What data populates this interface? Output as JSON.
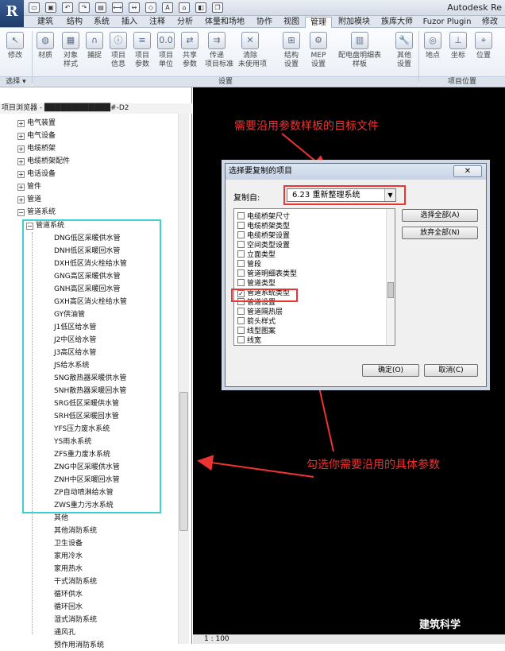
{
  "app": {
    "logo": "R",
    "title": "Autodesk Re"
  },
  "qat": {
    "icons": [
      "open-icon",
      "save-icon",
      "undo-icon",
      "redo-icon",
      "print-icon",
      "measure-icon",
      "dimension-icon",
      "tag-icon",
      "text-icon",
      "3d-view-icon",
      "section-icon",
      "window-icon"
    ]
  },
  "tabs": [
    "建筑",
    "结构",
    "系统",
    "插入",
    "注释",
    "分析",
    "体量和场地",
    "协作",
    "视图",
    "管理",
    "附加模块",
    "族库大师",
    "Fuzor Plugin",
    "修改"
  ],
  "active_tab": "管理",
  "ribbon": {
    "buttons": [
      {
        "label": "修改",
        "icon": "cursor-icon"
      },
      {
        "label": "材质",
        "icon": "material-icon"
      },
      {
        "label": "对象\n样式",
        "icon": "object-style-icon"
      },
      {
        "label": "捕捉",
        "icon": "snap-icon"
      },
      {
        "label": "项目\n信息",
        "icon": "project-info-icon"
      },
      {
        "label": "项目\n参数",
        "icon": "project-params-icon"
      },
      {
        "label": "项目\n单位",
        "icon": "project-units-icon"
      },
      {
        "label": "共享\n参数",
        "icon": "shared-params-icon"
      },
      {
        "label": "传递\n项目标准",
        "icon": "transfer-standards-icon"
      },
      {
        "label": "清除\n未使用项",
        "icon": "purge-icon"
      },
      {
        "label": "结构\n设置",
        "icon": "structural-settings-icon"
      },
      {
        "label": "MEP\n设置",
        "icon": "mep-settings-icon"
      },
      {
        "label": "配电盘明细表\n样板",
        "icon": "panel-schedule-icon"
      },
      {
        "label": "其他\n设置",
        "icon": "other-settings-icon"
      },
      {
        "label": "地点",
        "icon": "location-icon"
      },
      {
        "label": "坐标",
        "icon": "coordinates-icon"
      },
      {
        "label": "位置",
        "icon": "position-icon"
      }
    ],
    "panels": [
      "选择 ▾",
      "设置",
      "项目位置"
    ]
  },
  "browser": {
    "title": "项目浏览器 - ████████████#-D2",
    "top_items": [
      "电气装置",
      "电气设备",
      "电缆桥架",
      "电缆桥架配件",
      "电话设备",
      "管件",
      "管道",
      "管道系统"
    ],
    "group": "管道系统",
    "sub_items": [
      "DNG低区采暖供水管",
      "DNH低区采暖回水管",
      "DXH低区消火栓给水管",
      "GNG高区采暖供水管",
      "GNH高区采暖回水管",
      "GXH高区消火栓给水管",
      "GY供油管",
      "J1低区给水管",
      "J2中区给水管",
      "J3高区给水管",
      "JS给水系统",
      "SNG散热器采暖供水管",
      "SNH散热器采暖回水管",
      "SRG低区采暖供水管",
      "SRH低区采暖回水管",
      "YFS压力废水系统",
      "YS雨水系统",
      "ZFS重力废水系统",
      "ZNG中区采暖供水管",
      "ZNH中区采暖回水管",
      "ZP自动喷淋给水管",
      "ZWS重力污水系统"
    ],
    "more_items": [
      "其他",
      "其他消防系统",
      "卫生设备",
      "家用冷水",
      "家用热水",
      "干式消防系统",
      "循环供水",
      "循环回水",
      "湿式消防系统",
      "通风孔",
      "预作用消防系统"
    ]
  },
  "annotations": {
    "top": "需要沿用参数样板的目标文件",
    "bottom": "勾选你需要沿用的具体参数"
  },
  "dialog": {
    "title": "选择要复制的项目",
    "close": "✕",
    "copy_from_label": "复制自:",
    "copy_from_value": "6.23 重新整理系统",
    "items": [
      {
        "label": "电缆桥架尺寸",
        "checked": false
      },
      {
        "label": "电缆桥架类型",
        "checked": false
      },
      {
        "label": "电缆桥架设置",
        "checked": false
      },
      {
        "label": "空间类型设置",
        "checked": false
      },
      {
        "label": "立面类型",
        "checked": false
      },
      {
        "label": "管段",
        "checked": false
      },
      {
        "label": "管道明细表类型",
        "checked": false
      },
      {
        "label": "管道类型",
        "checked": false
      },
      {
        "label": "管道系统类型",
        "checked": true
      },
      {
        "label": "管道设置",
        "checked": false
      },
      {
        "label": "管道隔热层",
        "checked": false
      },
      {
        "label": "箭头样式",
        "checked": false
      },
      {
        "label": "线型图案",
        "checked": false
      },
      {
        "label": "线宽",
        "checked": false
      }
    ],
    "select_all": "选择全部(A)",
    "deselect_all": "放弃全部(N)",
    "ok": "确定(O)",
    "cancel": "取消(C)"
  },
  "status": {
    "scale": "1 : 100"
  },
  "watermark": "建筑科学"
}
